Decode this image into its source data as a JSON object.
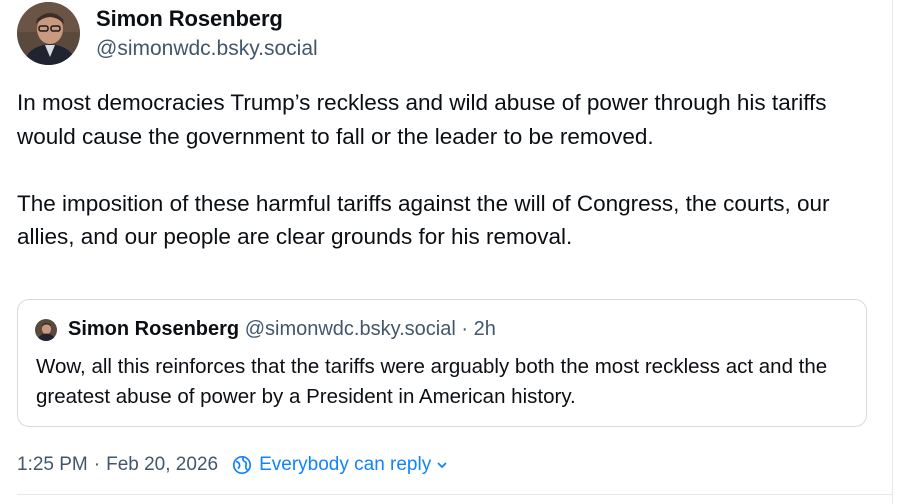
{
  "post": {
    "author": {
      "name": "Simon Rosenberg",
      "handle": "@simonwdc.bsky.social",
      "avatar_icon": "avatar-photo"
    },
    "text": "In most democracies Trump’s reckless and wild abuse of power through his tariffs would cause the government to fall or the leader to be removed.\n\nThe imposition of these harmful tariffs against the will of Congress, the courts, our allies, and our people are clear grounds for his removal.",
    "quote": {
      "author_name": "Simon Rosenberg",
      "author_handle": "@simonwdc.bsky.social",
      "separator": "·",
      "time": "2h",
      "text": "Wow, all this reinforces that the tariffs were arguably both the most reckless act and the greatest abuse of power by a President in American history."
    },
    "timestamp": "1:25 PM",
    "meta_separator": "·",
    "date": "Feb 20, 2026",
    "reply_setting": {
      "label": "Everybody can reply",
      "icon": "globe-reply-icon",
      "chevron": "chevron-down-icon"
    }
  },
  "colors": {
    "text": "#0b0f14",
    "muted": "#42576c",
    "link": "#1083fe",
    "border": "#d4dbe2"
  }
}
